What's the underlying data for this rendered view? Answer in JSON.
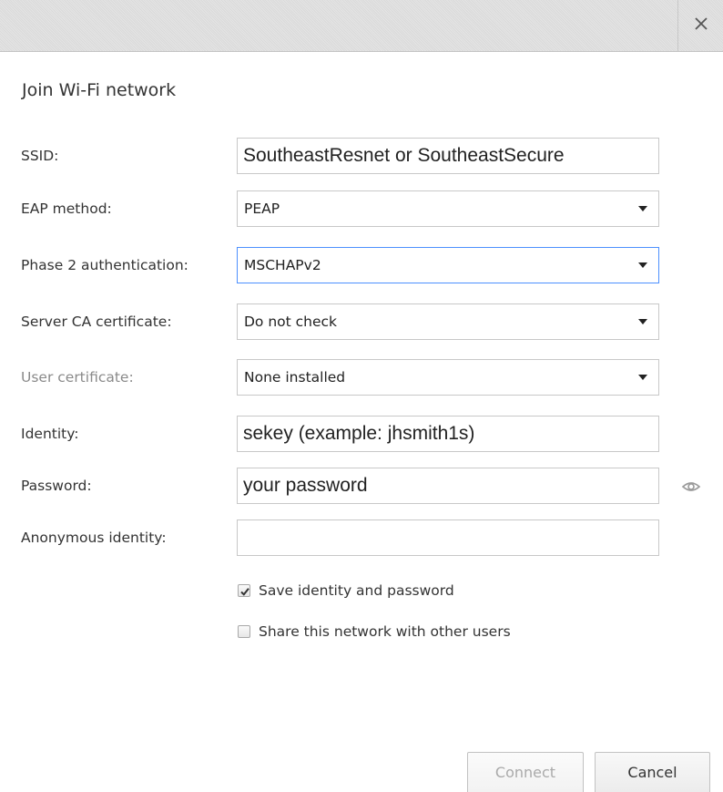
{
  "titlebar": {
    "close_icon": "close-icon"
  },
  "dialog": {
    "title": "Join Wi-Fi network"
  },
  "form": {
    "ssid": {
      "label": "SSID:",
      "value": "SoutheastResnet or SoutheastSecure"
    },
    "eap_method": {
      "label": "EAP method:",
      "value": "PEAP"
    },
    "phase2": {
      "label": "Phase 2 authentication:",
      "value": "MSCHAPv2"
    },
    "server_ca": {
      "label": "Server CA certificate:",
      "value": "Do not check"
    },
    "user_cert": {
      "label": "User certificate:",
      "value": "None installed"
    },
    "identity": {
      "label": "Identity:",
      "value": "sekey (example: jhsmith1s)"
    },
    "password": {
      "label": "Password:",
      "value": "your password",
      "show_icon": "eye-icon"
    },
    "anonymous_identity": {
      "label": "Anonymous identity:",
      "value": ""
    }
  },
  "options": {
    "save_identity": {
      "label": "Save identity and password",
      "checked": true
    },
    "share_network": {
      "label": "Share this network with other users",
      "checked": false
    }
  },
  "buttons": {
    "connect": "Connect",
    "cancel": "Cancel"
  },
  "colors": {
    "focus_border": "#4d90fe",
    "disabled_text": "#8a8a8a"
  }
}
